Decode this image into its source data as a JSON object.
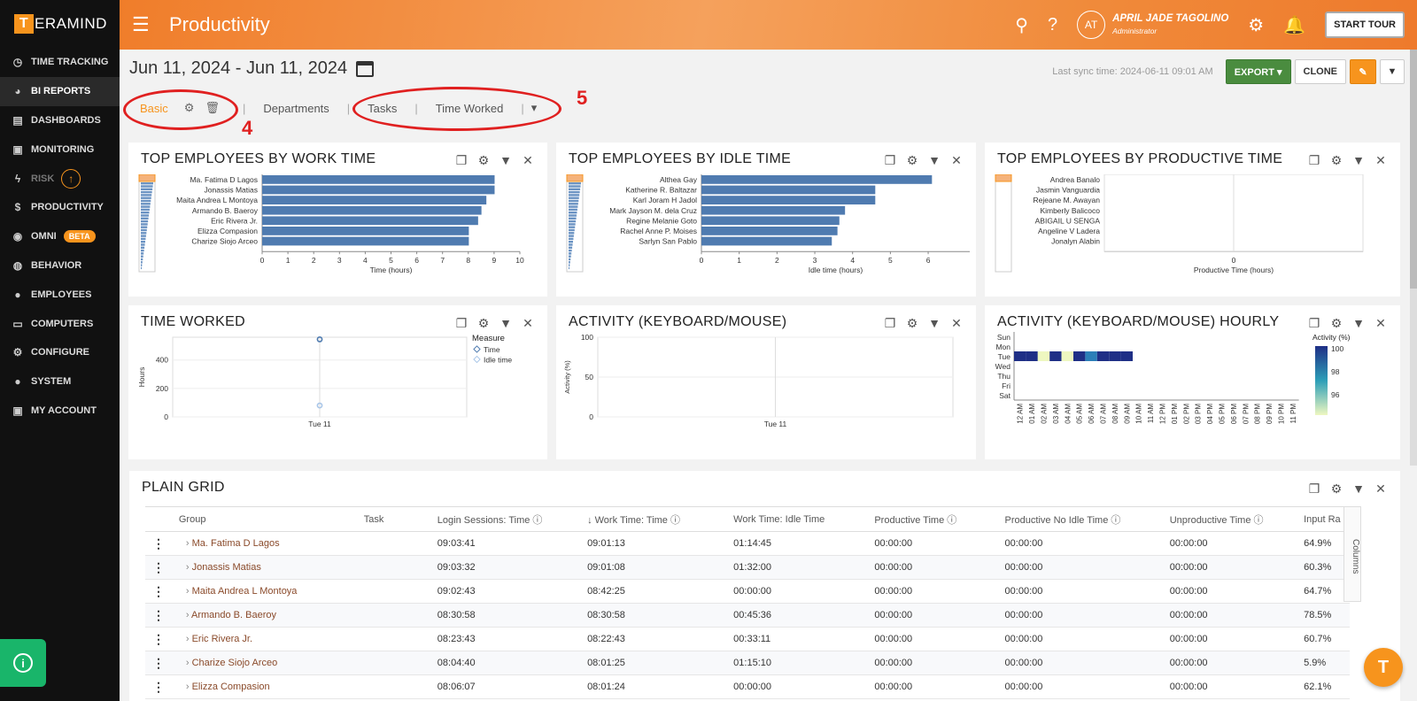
{
  "sidebar": {
    "logo_letter": "T",
    "logo_text": "ERAMIND",
    "items": [
      {
        "label": "TIME TRACKING",
        "icon": "clock-icon"
      },
      {
        "label": "BI REPORTS",
        "icon": "pie-chart-icon"
      },
      {
        "label": "DASHBOARDS",
        "icon": "chart-icon"
      },
      {
        "label": "MONITORING",
        "icon": "monitor-icon"
      },
      {
        "label": "RISK",
        "icon": "bolt-icon"
      },
      {
        "label": "PRODUCTIVITY",
        "icon": "dollar-icon"
      },
      {
        "label": "OMNI",
        "icon": "bulb-icon",
        "badge": "BETA"
      },
      {
        "label": "BEHAVIOR",
        "icon": "gamepad-icon"
      },
      {
        "label": "EMPLOYEES",
        "icon": "user-icon"
      },
      {
        "label": "COMPUTERS",
        "icon": "desktop-icon"
      },
      {
        "label": "CONFIGURE",
        "icon": "gear-icon"
      },
      {
        "label": "SYSTEM",
        "icon": "user-cog-icon"
      },
      {
        "label": "MY ACCOUNT",
        "icon": "id-card-icon"
      }
    ],
    "info_icon": "i"
  },
  "header": {
    "title": "Productivity",
    "avatar": "AT",
    "user_name": "APRIL JADE TAGOLINO",
    "user_role": "Administrator",
    "tour_button": "START TOUR"
  },
  "toolbar": {
    "date_range": "Jun 11, 2024 - Jun 11, 2024",
    "sync_text": "Last sync time: 2024-06-11 09:01 AM",
    "export_label": "EXPORT ▾",
    "clone_label": "CLONE"
  },
  "tabs": {
    "basic": "Basic",
    "departments": "Departments",
    "tasks": "Tasks",
    "time_worked": "Time Worked",
    "more": "▾"
  },
  "annotations": {
    "a4": "4",
    "a5": "5"
  },
  "panels": {
    "work": {
      "title": "TOP EMPLOYEES BY WORK TIME",
      "chart_data": {
        "type": "bar",
        "categories": [
          "Ma. Fatima D Lagos",
          "Jonassis Matias",
          "Maita Andrea L Montoya",
          "Armando B. Baeroy",
          "Eric Rivera Jr.",
          "Elizza Compasion",
          "Charize Siojo Arceo"
        ],
        "values": [
          9.02,
          9.02,
          8.7,
          8.51,
          8.38,
          8.02,
          8.02
        ],
        "xlabel": "Time (hours)",
        "xlim": [
          0,
          10
        ],
        "ticks": [
          "0",
          "1",
          "2",
          "3",
          "4",
          "5",
          "6",
          "7",
          "8",
          "9",
          "10"
        ]
      }
    },
    "idle": {
      "title": "TOP EMPLOYEES BY IDLE TIME",
      "chart_data": {
        "type": "bar",
        "categories": [
          "Althea Gay",
          "Katherine R. Baltazar",
          "Karl Joram H Jadol",
          "Mark Jayson M. dela Cruz",
          "Regine Melanie Goto",
          "Rachel Anne P. Moises",
          "Sarlyn San Pablo"
        ],
        "values": [
          6.1,
          4.6,
          4.6,
          3.8,
          3.65,
          3.6,
          3.45
        ],
        "xlabel": "Idle time (hours)",
        "xlim": [
          0,
          6.5
        ],
        "ticks": [
          "0",
          "1",
          "2",
          "3",
          "4",
          "5",
          "6"
        ]
      }
    },
    "productive": {
      "title": "TOP EMPLOYEES BY PRODUCTIVE TIME",
      "chart_data": {
        "type": "bar",
        "categories": [
          "Andrea Banalo",
          "Jasmin Vanguardia",
          "Rejeane M. Awayan",
          "Kimberly Balicoco",
          "ABIGAIL U SENGA",
          "Angeline V Ladera",
          "Jonalyn Alabin"
        ],
        "values": [
          0,
          0,
          0,
          0,
          0,
          0,
          0
        ],
        "xlabel": "Productive Time (hours)",
        "ticks": [
          "0"
        ]
      }
    },
    "time_worked": {
      "title": "TIME WORKED",
      "chart_data": {
        "type": "scatter",
        "categories": [
          "Tue 11"
        ],
        "series": [
          {
            "name": "Time",
            "values": [
              545
            ]
          },
          {
            "name": "Idle time",
            "values": [
              80
            ]
          }
        ],
        "ylabel": "Hours",
        "ylim": [
          0,
          550
        ],
        "yticks": [
          "400",
          "200",
          "0"
        ],
        "legend_title": "Measure"
      }
    },
    "activity": {
      "title": "ACTIVITY (KEYBOARD/MOUSE)",
      "chart_data": {
        "type": "line",
        "categories": [
          "Tue 11"
        ],
        "ylabel": "Activity (%)",
        "ylim": [
          0,
          100
        ],
        "yticks": [
          "100",
          "50",
          "0"
        ]
      }
    },
    "hourly": {
      "title": "ACTIVITY (KEYBOARD/MOUSE) HOURLY",
      "chart_data": {
        "type": "heatmap",
        "rows": [
          "Sun",
          "Mon",
          "Tue",
          "Wed",
          "Thu",
          "Fri",
          "Sat"
        ],
        "cols": [
          "12 AM",
          "01 AM",
          "02 AM",
          "03 AM",
          "04 AM",
          "05 AM",
          "06 AM",
          "07 AM",
          "08 AM",
          "09 AM",
          "10 AM",
          "11 AM",
          "12 PM",
          "01 PM",
          "02 PM",
          "03 PM",
          "04 PM",
          "05 PM",
          "06 PM",
          "07 PM",
          "08 PM",
          "09 PM",
          "10 PM",
          "11 PM"
        ],
        "tue_values": [
          100,
          100,
          95,
          100,
          95,
          100,
          98,
          100,
          100,
          100
        ],
        "legend_title": "Activity (%)",
        "legend_ticks": [
          "100",
          "98",
          "96"
        ]
      }
    }
  },
  "grid": {
    "title": "PLAIN GRID",
    "columns": [
      "Group",
      "Task",
      "Login Sessions: Time",
      "↓ Work Time: Time",
      "Work Time: Idle Time",
      "Productive Time",
      "Productive No Idle Time",
      "Unproductive Time",
      "Input Ra"
    ],
    "columns_tab": "Columns",
    "rows": [
      [
        "Ma. Fatima D Lagos",
        "",
        "09:03:41",
        "09:01:13",
        "01:14:45",
        "00:00:00",
        "00:00:00",
        "00:00:00",
        "64.9%"
      ],
      [
        "Jonassis Matias",
        "",
        "09:03:32",
        "09:01:08",
        "01:32:00",
        "00:00:00",
        "00:00:00",
        "00:00:00",
        "60.3%"
      ],
      [
        "Maita Andrea L Montoya",
        "",
        "09:02:43",
        "08:42:25",
        "00:00:00",
        "00:00:00",
        "00:00:00",
        "00:00:00",
        "64.7%"
      ],
      [
        "Armando B. Baeroy",
        "",
        "08:30:58",
        "08:30:58",
        "00:45:36",
        "00:00:00",
        "00:00:00",
        "00:00:00",
        "78.5%"
      ],
      [
        "Eric Rivera Jr.",
        "",
        "08:23:43",
        "08:22:43",
        "00:33:11",
        "00:00:00",
        "00:00:00",
        "00:00:00",
        "60.7%"
      ],
      [
        "Charize Siojo Arceo",
        "",
        "08:04:40",
        "08:01:25",
        "01:15:10",
        "00:00:00",
        "00:00:00",
        "00:00:00",
        "5.9%"
      ],
      [
        "Elizza Compasion",
        "",
        "08:06:07",
        "08:01:24",
        "00:00:00",
        "00:00:00",
        "00:00:00",
        "00:00:00",
        "62.1%"
      ]
    ]
  },
  "fab_label": "T",
  "colors": {
    "accent": "#f7941d",
    "bar": "#4f7bb0",
    "export": "#4a8c3f",
    "annotation": "#e02020"
  }
}
